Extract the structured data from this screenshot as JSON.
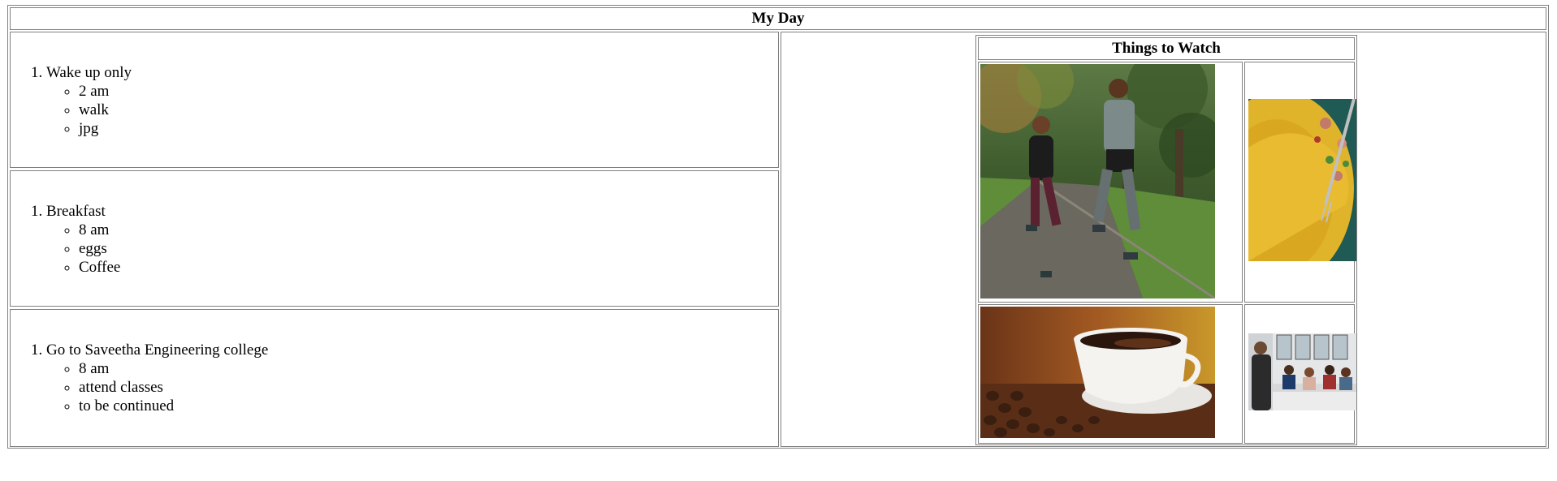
{
  "page": {
    "title": "My Day"
  },
  "tasks": [
    {
      "label": "Wake up only",
      "details": [
        "2 am",
        "walk",
        "jpg"
      ]
    },
    {
      "label": "Breakfast",
      "details": [
        "8 am",
        "eggs",
        "Coffee"
      ]
    },
    {
      "label": "Go to Saveetha Engineering college",
      "details": [
        "8 am",
        "attend classes",
        "to be continued"
      ]
    }
  ],
  "watch": {
    "title": "Things to Watch"
  }
}
